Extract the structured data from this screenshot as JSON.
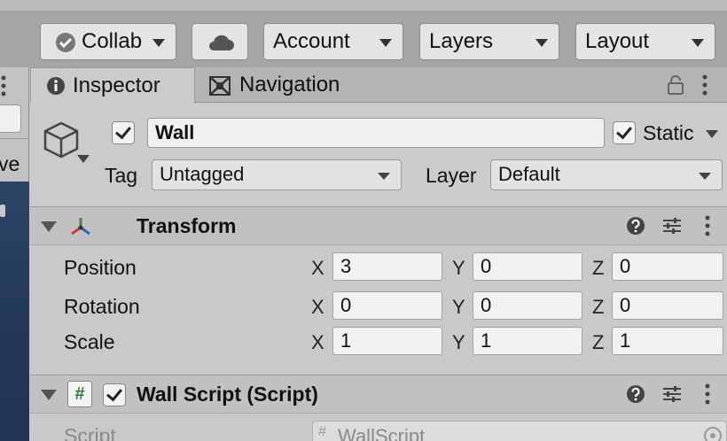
{
  "toolbar": {
    "collab_label": "Collab",
    "account_label": "Account",
    "layers_label": "Layers",
    "layout_label": "Layout"
  },
  "left_panel": {
    "partial_text": "ve"
  },
  "tabs": {
    "inspector": "Inspector",
    "navigation": "Navigation"
  },
  "object": {
    "name": "Wall",
    "active": true,
    "static_label": "Static",
    "static": true,
    "tag_label": "Tag",
    "tag_value": "Untagged",
    "layer_label": "Layer",
    "layer_value": "Default"
  },
  "transform": {
    "title": "Transform",
    "position_label": "Position",
    "rotation_label": "Rotation",
    "scale_label": "Scale",
    "axis_x": "X",
    "axis_y": "Y",
    "axis_z": "Z",
    "position": {
      "x": "3",
      "y": "0",
      "z": "0"
    },
    "rotation": {
      "x": "0",
      "y": "0",
      "z": "0"
    },
    "scale": {
      "x": "1",
      "y": "1",
      "z": "1"
    }
  },
  "script_component": {
    "title": "Wall Script (Script)",
    "enabled": true,
    "script_label": "Script",
    "script_value": "WallScript",
    "script_glyph": "#"
  },
  "colors": {
    "toolbar_bg": "#a5a5a5",
    "panel_bg": "#cbcbcb",
    "scene_bg": "#24395a",
    "axis_x": "#d33b2c",
    "axis_y": "#3d8f3a",
    "axis_z": "#2f62c8",
    "script_icon": "#2e7d32"
  },
  "icons": [
    "collab-check-icon",
    "cloud-icon",
    "info-icon",
    "navigation-icon",
    "lock-icon",
    "kebab-menu-icon",
    "gameobject-cube-icon",
    "transform-axis-icon",
    "help-icon",
    "presets-icon",
    "script-hash-icon",
    "object-picker-icon"
  ]
}
